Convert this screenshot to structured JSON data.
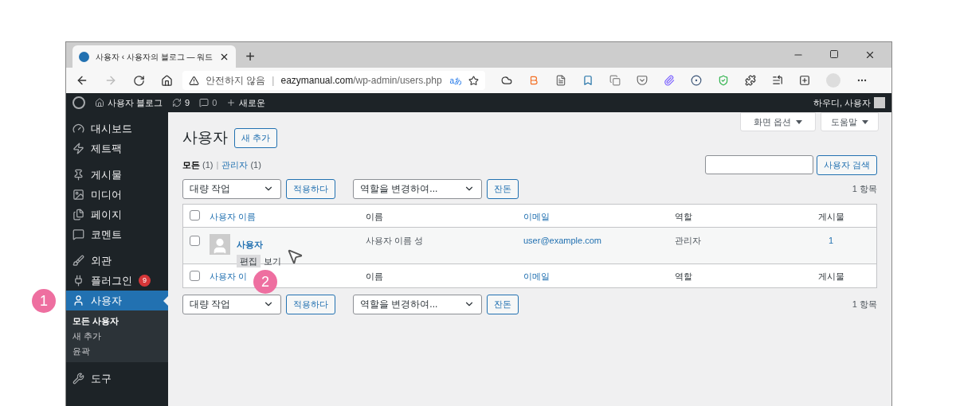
{
  "browser": {
    "tab_title": "사용자 ‹ 사용자의 블로그 — 워드",
    "new_tab": "+",
    "url_warning": "안전하지 않음",
    "url_separator": "|",
    "url_host": "eazymanual.com",
    "url_path": "/wp-admin/users.php",
    "read_aloud": "aあ"
  },
  "admin_bar": {
    "site": "사용자 블로그",
    "updates": "9",
    "comments": "0",
    "new": "새로운",
    "greeting": "하우디, 사용자"
  },
  "sidebar": {
    "groups": [
      [
        {
          "label": "대시보드",
          "selected": false
        },
        {
          "label": "제트팩",
          "selected": false
        }
      ],
      [
        {
          "label": "게시물",
          "selected": false
        },
        {
          "label": "미디어",
          "selected": false
        },
        {
          "label": "페이지",
          "selected": false
        },
        {
          "label": "코멘트",
          "selected": false
        }
      ],
      [
        {
          "label": "외관",
          "selected": false
        },
        {
          "label": "플러그인",
          "selected": false,
          "badge": "9"
        },
        {
          "label": "사용자",
          "selected": true
        }
      ]
    ],
    "submenu": [
      {
        "label": "모든 사용자",
        "selected": true
      },
      {
        "label": "새 추가",
        "selected": false
      },
      {
        "label": "윤곽",
        "selected": false
      }
    ],
    "after": [
      {
        "label": "도구",
        "selected": false
      }
    ]
  },
  "content": {
    "title": "사용자",
    "add_new": "새 추가",
    "screen_options": "화면 옵션",
    "help": "도움말",
    "filters": [
      {
        "label": "모든",
        "count": "(1)",
        "selected": true
      },
      {
        "label": "관리자",
        "count": "(1)",
        "selected": false
      }
    ],
    "filter_separator": "|",
    "search_button": "사용자 검색",
    "top_actions": {
      "bulk_action": "대량 작업",
      "apply": "적용하다",
      "change_role": "역할을 변경하여...",
      "change": "잔돈",
      "item_count": "1 항목"
    },
    "header_checked": false,
    "columns": [
      {
        "label": "사용자 이름",
        "link": true
      },
      {
        "label": "이름",
        "link": false
      },
      {
        "label": "이메일",
        "link": true
      },
      {
        "label": "역할",
        "link": false
      },
      {
        "label": "게시물",
        "link": false
      }
    ],
    "rows": [
      {
        "checked": false,
        "username": "사용자",
        "name": "사용자 이름 성",
        "email": "user@example.com",
        "role": "관리자",
        "posts": "1",
        "actions": [
          "편집",
          "보기"
        ]
      }
    ],
    "footer_checked": false,
    "footer_columns": [
      {
        "label": "사용자 이",
        "link": true
      },
      {
        "label": "이름",
        "link": false
      },
      {
        "label": "이메일",
        "link": true
      },
      {
        "label": "역할",
        "link": false
      },
      {
        "label": "게시물",
        "link": false
      }
    ],
    "bottom_actions": {
      "bulk_action": "대량 작업",
      "apply": "적용하다",
      "change_role": "역할을 변경하여...",
      "change": "잔돈",
      "item_count": "1 항목"
    }
  },
  "annotations": [
    {
      "label": "1"
    },
    {
      "label": "2"
    }
  ]
}
